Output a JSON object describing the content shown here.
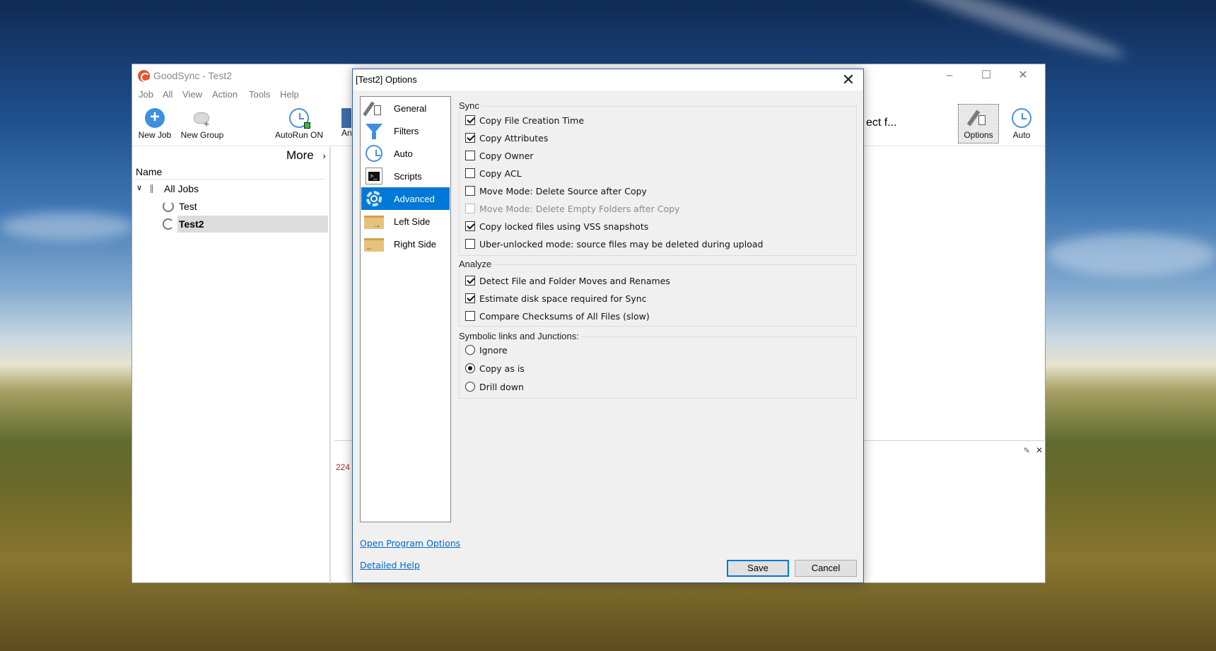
{
  "main_window": {
    "title": "GoodSync - Test2",
    "menu": [
      "Job",
      "All",
      "View",
      "Action",
      "Tools",
      "Help"
    ],
    "toolbar": {
      "new_job": "New Job",
      "new_group": "New Group",
      "autorun": "AutoRun ON",
      "analyze_partial": "An",
      "select_partial": "ect f...",
      "options": "Options",
      "auto": "Auto"
    },
    "more_label": "More",
    "tree_header": "Name",
    "tree": {
      "root": "All Jobs",
      "jobs": [
        "Test",
        "Test2"
      ]
    },
    "log_number_partial": "224"
  },
  "dialog": {
    "title": "[Test2] Options",
    "nav": [
      {
        "label": "General",
        "icon": "wrench-checklist-icon"
      },
      {
        "label": "Filters",
        "icon": "funnel-icon"
      },
      {
        "label": "Auto",
        "icon": "clock-icon"
      },
      {
        "label": "Scripts",
        "icon": "terminal-icon"
      },
      {
        "label": "Advanced",
        "icon": "gear-icon"
      },
      {
        "label": "Left Side",
        "icon": "folder-left-icon"
      },
      {
        "label": "Right Side",
        "icon": "folder-right-icon"
      }
    ],
    "selected_nav": "Advanced",
    "sync": {
      "title": "Sync",
      "options": [
        {
          "label": "Copy File Creation Time",
          "checked": true
        },
        {
          "label": "Copy Attributes",
          "checked": true
        },
        {
          "label": "Copy Owner",
          "checked": false
        },
        {
          "label": "Copy ACL",
          "checked": false
        },
        {
          "label": "Move Mode: Delete Source after Copy",
          "checked": false
        },
        {
          "label": "Move Mode: Delete Empty Folders after Copy",
          "checked": false,
          "disabled": true
        },
        {
          "label": "Copy locked files using VSS snapshots",
          "checked": true
        },
        {
          "label": "Uber-unlocked mode: source files may be deleted during upload",
          "checked": false
        }
      ]
    },
    "analyze": {
      "title": "Analyze",
      "options": [
        {
          "label": "Detect File and Folder Moves and Renames",
          "checked": true
        },
        {
          "label": "Estimate disk space required for Sync",
          "checked": true
        },
        {
          "label": "Compare Checksums of All Files (slow)",
          "checked": false
        }
      ]
    },
    "symlinks": {
      "title": "Symbolic links and Junctions:",
      "options": [
        {
          "label": "Ignore",
          "selected": false
        },
        {
          "label": "Copy as is",
          "selected": true
        },
        {
          "label": "Drill down",
          "selected": false
        }
      ]
    },
    "links": {
      "program_options": "Open Program Options",
      "help": "Detailed Help"
    },
    "buttons": {
      "save": "Save",
      "cancel": "Cancel"
    }
  }
}
